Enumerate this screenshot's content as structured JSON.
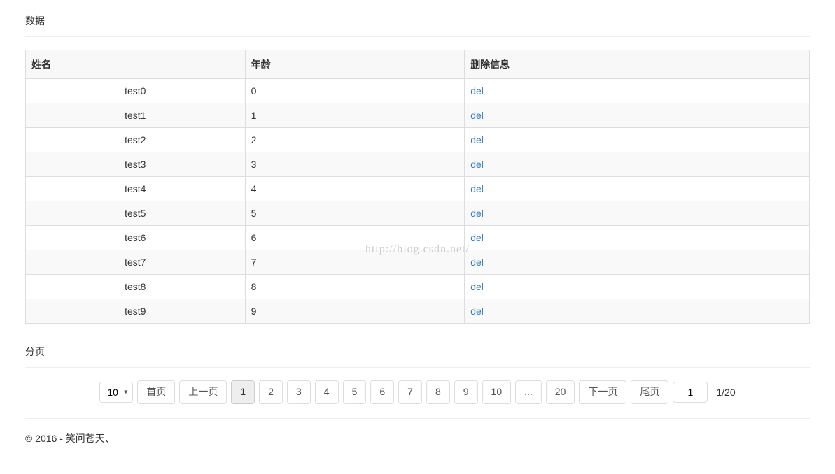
{
  "sections": {
    "data_title": "数据",
    "pagination_title": "分页"
  },
  "table": {
    "headers": {
      "name": "姓名",
      "age": "年龄",
      "delete": "删除信息"
    },
    "rows": [
      {
        "name": "test0",
        "age": "0",
        "del": "del"
      },
      {
        "name": "test1",
        "age": "1",
        "del": "del"
      },
      {
        "name": "test2",
        "age": "2",
        "del": "del"
      },
      {
        "name": "test3",
        "age": "3",
        "del": "del"
      },
      {
        "name": "test4",
        "age": "4",
        "del": "del"
      },
      {
        "name": "test5",
        "age": "5",
        "del": "del"
      },
      {
        "name": "test6",
        "age": "6",
        "del": "del"
      },
      {
        "name": "test7",
        "age": "7",
        "del": "del"
      },
      {
        "name": "test8",
        "age": "8",
        "del": "del"
      },
      {
        "name": "test9",
        "age": "9",
        "del": "del"
      }
    ]
  },
  "pagination": {
    "page_size": "10",
    "first": "首页",
    "prev": "上一页",
    "pages": [
      "1",
      "2",
      "3",
      "4",
      "5",
      "6",
      "7",
      "8",
      "9",
      "10",
      "...",
      "20"
    ],
    "active_page": "1",
    "next": "下一页",
    "last": "尾页",
    "goto_value": "1",
    "info": "1/20"
  },
  "footer": "© 2016 - 笑问苍天、",
  "watermark": "http://blog.csdn.net/"
}
